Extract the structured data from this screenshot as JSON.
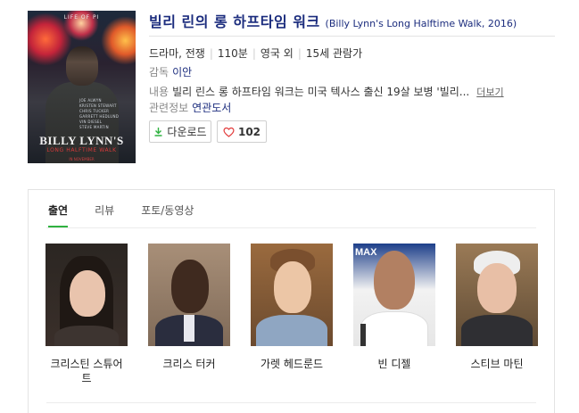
{
  "movie": {
    "title_ko": "빌리 린의 롱 하프타임 워크",
    "title_en": "(Billy Lynn's Long Halftime Walk, 2016)",
    "meta": [
      "드라마, 전쟁",
      "110분",
      "영국 외",
      "15세 관람가"
    ],
    "director_label": "감독",
    "director": "이안",
    "synopsis_label": "내용",
    "synopsis": "빌리 린스 롱 하프타임 워크는 미국 텍사스 출신 19살 보병 '빌리...",
    "more_link": "더보기",
    "related_label": "관련정보",
    "related_link": "연관도서"
  },
  "poster": {
    "top_text": "LIFE OF PI",
    "credits": [
      "JOE ALWYN",
      "KRISTEN STEWART",
      "CHRIS TUCKER",
      "GARRETT HEDLUND",
      "VIN DIESEL",
      "STEVE MARTIN"
    ],
    "title_main": "BILLY LYNN'S",
    "title_sub": "LONG HALFTIME WALK",
    "release": "IN NOVEMBER"
  },
  "actions": {
    "download_label": "다운로드",
    "like_count": "102"
  },
  "tabs": [
    "출연",
    "리뷰",
    "포토/동영상"
  ],
  "cast": [
    {
      "name": "크리스틴 스튜어트"
    },
    {
      "name": "크리스 터커"
    },
    {
      "name": "가렛 헤드룬드"
    },
    {
      "name": "빈 디젤"
    },
    {
      "name": "스티브 마틴"
    }
  ],
  "colors": {
    "title": "#1c2d7e",
    "active_tab_underline": "#2fb240",
    "heart": "#e23c3c",
    "download_arrow": "#2fb240"
  }
}
